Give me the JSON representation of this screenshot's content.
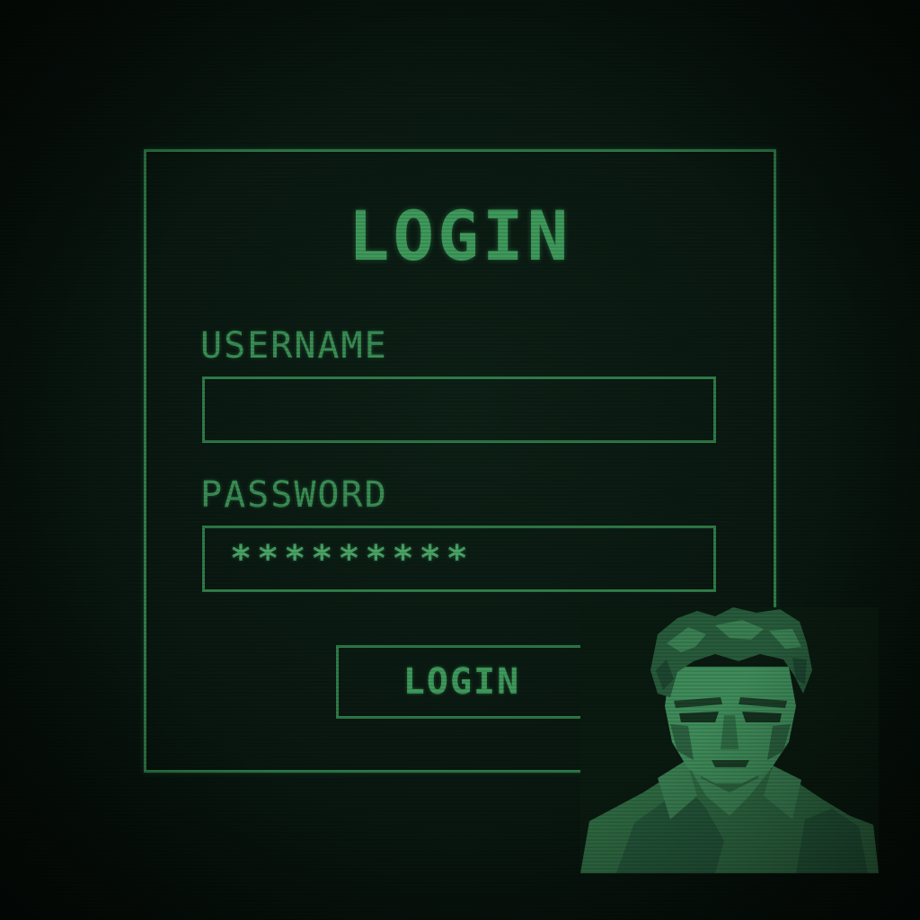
{
  "form": {
    "title": "LOGIN",
    "username_label": "USERNAME",
    "username_value": "",
    "password_label": "PASSWORD",
    "password_value": "*********",
    "submit_label": "LOGIN"
  },
  "colors": {
    "background": "#0a1a10",
    "accent": "#3f9a5c",
    "border": "#2f7d48"
  },
  "portrait": {
    "icon": "operative-portrait"
  }
}
